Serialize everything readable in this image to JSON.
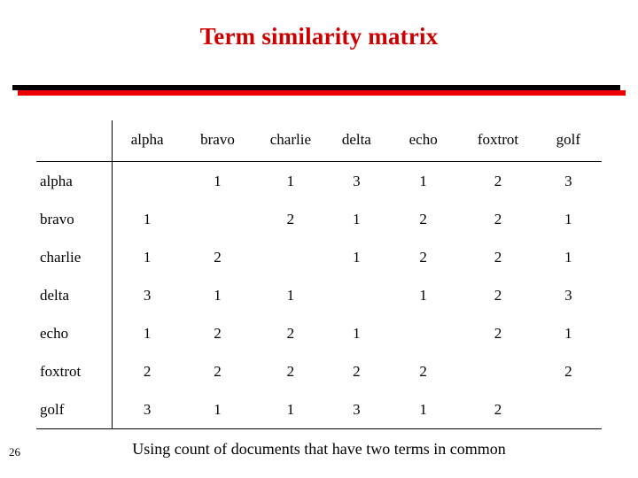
{
  "slide": {
    "title": "Term similarity matrix",
    "footnote": "Using count of documents that have two terms in common",
    "page_number": "26",
    "accent_color": "#cc0000",
    "rule_colors": {
      "top": "#000000",
      "bottom": "#ee0000"
    }
  },
  "matrix": {
    "corner_label": "",
    "columns": [
      "alpha",
      "bravo",
      "charlie",
      "delta",
      "echo",
      "foxtrot",
      "golf"
    ],
    "rows": [
      {
        "label": "alpha",
        "cells": [
          "",
          "1",
          "1",
          "3",
          "1",
          "2",
          "3"
        ]
      },
      {
        "label": "bravo",
        "cells": [
          "1",
          "",
          "2",
          "1",
          "2",
          "2",
          "1"
        ]
      },
      {
        "label": "charlie",
        "cells": [
          "1",
          "2",
          "",
          "1",
          "2",
          "2",
          "1"
        ]
      },
      {
        "label": "delta",
        "cells": [
          "3",
          "1",
          "1",
          "",
          "1",
          "2",
          "3"
        ]
      },
      {
        "label": "echo",
        "cells": [
          "1",
          "2",
          "2",
          "1",
          "",
          "2",
          "1"
        ]
      },
      {
        "label": "foxtrot",
        "cells": [
          "2",
          "2",
          "2",
          "2",
          "2",
          "",
          "2"
        ]
      },
      {
        "label": "golf",
        "cells": [
          "3",
          "1",
          "1",
          "3",
          "1",
          "2",
          ""
        ]
      }
    ]
  }
}
